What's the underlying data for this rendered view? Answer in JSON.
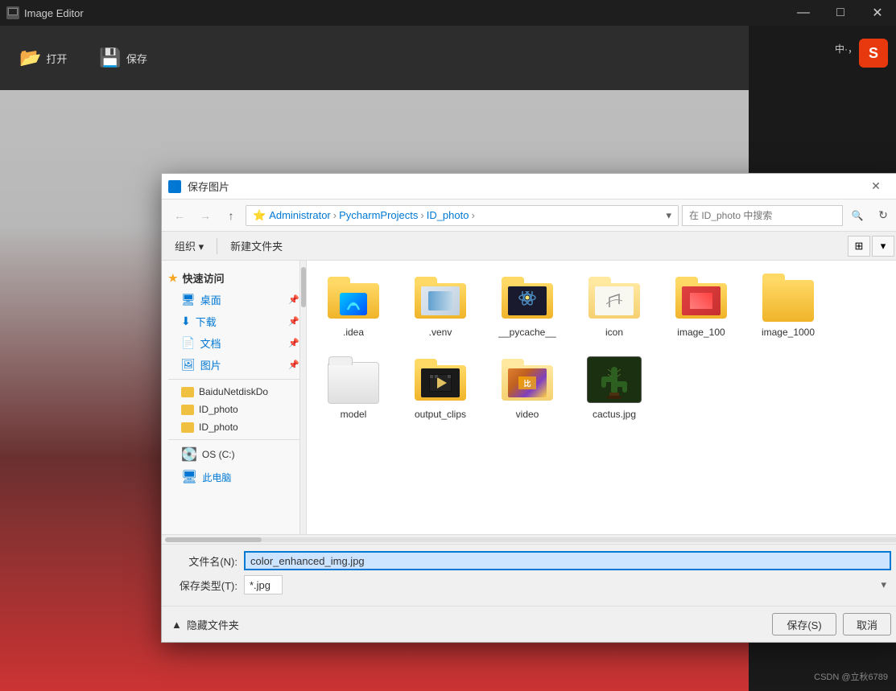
{
  "app": {
    "title": "Image Editor",
    "titlebar_icon": "▣"
  },
  "titlebar_controls": {
    "minimize": "—",
    "maximize": "□",
    "close": "✕"
  },
  "toolbar": {
    "open_label": "打开",
    "save_label": "保存"
  },
  "right_panel": {
    "csdn_label": "S",
    "csdn_text": "中·，",
    "csdn_watermark": "CSDN @立秋6789"
  },
  "dialog": {
    "title": "保存图片",
    "nav": {
      "back_disabled": true,
      "forward_disabled": true,
      "up_enabled": true,
      "path": "Administrator > PycharmProjects > ID_photo >",
      "path_parts": [
        "Administrator",
        "PycharmProjects",
        "ID_photo"
      ],
      "search_placeholder": "在 ID_photo 中搜索"
    },
    "toolbar": {
      "organize_label": "组织 ▾",
      "new_folder_label": "新建文件夹"
    },
    "sidebar": {
      "quick_access_label": "快速访问",
      "items": [
        {
          "name": "桌面",
          "icon": "🖥",
          "pinned": true
        },
        {
          "name": "下载",
          "icon": "⬇",
          "pinned": true
        },
        {
          "name": "文档",
          "icon": "📄",
          "pinned": true
        },
        {
          "name": "图片",
          "icon": "🖼",
          "pinned": true
        }
      ],
      "folders": [
        {
          "name": "BaiduNetdiskDo",
          "icon": "folder-yellow"
        },
        {
          "name": "ID_photo",
          "icon": "folder-yellow"
        },
        {
          "name": "ID_photo",
          "icon": "folder-yellow"
        },
        {
          "name": "OS (C:)",
          "icon": "drive"
        },
        {
          "name": "此电脑",
          "icon": "computer"
        }
      ]
    },
    "files": [
      {
        "name": ".idea",
        "type": "folder-idea"
      },
      {
        "name": ".venv",
        "type": "folder-striped"
      },
      {
        "name": "__pycache__",
        "type": "folder-python"
      },
      {
        "name": "icon",
        "type": "folder-icon"
      },
      {
        "name": "image_100",
        "type": "folder-photos"
      },
      {
        "name": "image_1000",
        "type": "folder-yellow"
      },
      {
        "name": "model",
        "type": "folder-white"
      },
      {
        "name": "output_clips",
        "type": "folder-video"
      },
      {
        "name": "video",
        "type": "folder-scenic"
      },
      {
        "name": "cactus.jpg",
        "type": "image-cactus"
      }
    ],
    "form": {
      "filename_label": "文件名(N):",
      "filename_value": "color_enhanced_img.jpg",
      "filetype_label": "保存类型(T):",
      "filetype_value": "*.jpg"
    },
    "footer": {
      "hide_folders_label": "隐藏文件夹",
      "save_btn": "保存(S)",
      "cancel_btn": "取消"
    }
  }
}
